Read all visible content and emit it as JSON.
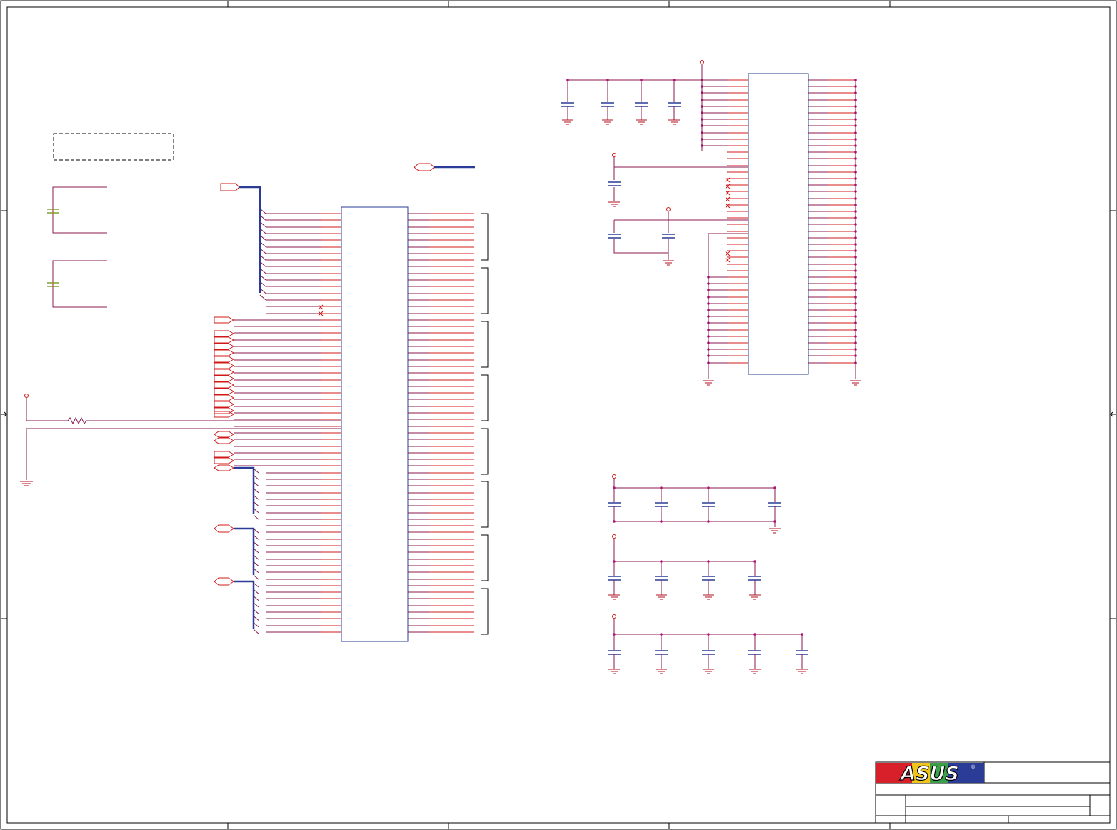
{
  "title_block": {
    "logo_text": "ASUS",
    "registered_mark": "®",
    "colors": {
      "logo_red": "#d8202a",
      "logo_blue": "#2a3c96",
      "logo_yellow": "#f0c418",
      "logo_green": "#3aa04a"
    }
  },
  "colors": {
    "net_wire": "#d01818",
    "pin_wire": "#8b1a52",
    "bus_and_component": "#2a3c96",
    "junction": "#b3107a",
    "decoupling_cap_alt": "#7a9a1a",
    "border": "#000000"
  }
}
